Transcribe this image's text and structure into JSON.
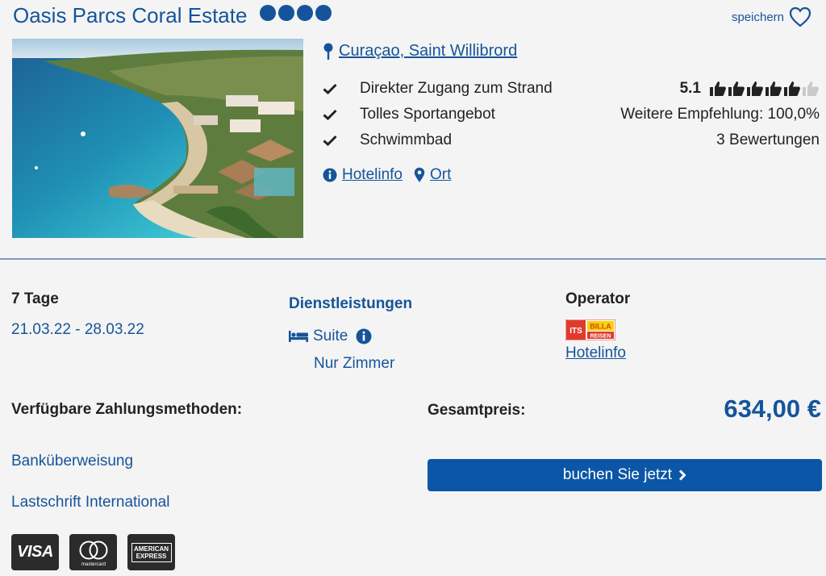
{
  "hotel": {
    "name": "Oasis Parcs Coral Estate",
    "stars": 4,
    "save_label": "speichern"
  },
  "location": {
    "label": "Curaçao, Saint Willibrord"
  },
  "features": [
    "Direkter Zugang zum Strand",
    "Tolles Sportangebot",
    "Schwimmbad"
  ],
  "rating": {
    "score": "5.1",
    "thumbs_filled": 5.1,
    "thumbs_total": 6,
    "recommendation": "Weitere Empfehlung: 100,0%",
    "reviews": "3 Bewertungen"
  },
  "links": {
    "hotelinfo": "Hotelinfo",
    "map": "Ort"
  },
  "trip": {
    "duration": "7 Tage",
    "dates": "21.03.22 - 28.03.22"
  },
  "services": {
    "title": "Dienstleistungen",
    "room": "Suite",
    "board": "Nur Zimmer"
  },
  "operator": {
    "title": "Operator",
    "logo_text_1": "ITS",
    "logo_text_2": "BILLA",
    "logo_text_3": "REISEN",
    "link": "Hotelinfo"
  },
  "payment": {
    "title": "Verfügbare Zahlungsmethoden:",
    "methods": [
      "Banküberweisung",
      "Lastschrift International"
    ],
    "cards": {
      "visa": "VISA",
      "mastercard": "mastercard",
      "amex_1": "AMERICAN",
      "amex_2": "EXPRESS"
    }
  },
  "price": {
    "label": "Gesamtpreis:",
    "value": "634,00 €"
  },
  "cta": {
    "label": "buchen Sie jetzt"
  },
  "colors": {
    "accent": "#15549a",
    "button": "#0b56a6"
  }
}
